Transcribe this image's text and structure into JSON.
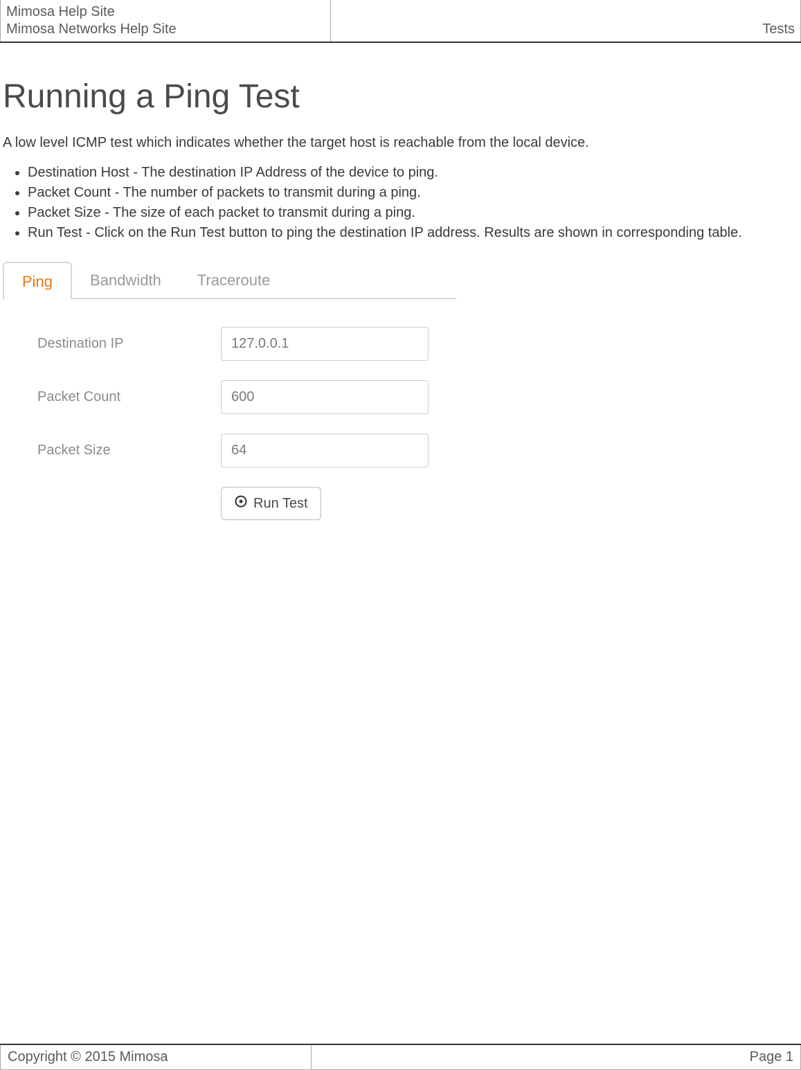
{
  "header": {
    "line1": "Mimosa Help Site",
    "line2": "Mimosa Networks Help Site",
    "right": "Tests"
  },
  "page": {
    "title": "Running a Ping Test",
    "intro": "A low level ICMP test which indicates whether the target host is reachable from the local device.",
    "bullets": [
      "Destination Host - The destination IP Address of the device to ping.",
      "Packet Count - The number of packets to transmit during a ping.",
      "Packet Size - The size of each packet to transmit during a ping.",
      "Run Test - Click on the Run Test button to ping the destination IP address. Results are shown in corresponding table."
    ]
  },
  "tabs": {
    "items": [
      "Ping",
      "Bandwidth",
      "Traceroute"
    ],
    "active": "Ping"
  },
  "form": {
    "destination_ip": {
      "label": "Destination IP",
      "value": "127.0.0.1"
    },
    "packet_count": {
      "label": "Packet Count",
      "value": "600"
    },
    "packet_size": {
      "label": "Packet Size",
      "value": "64"
    },
    "run_button_label": "Run Test"
  },
  "footer": {
    "copyright": "Copyright © 2015 Mimosa",
    "page": "Page 1"
  }
}
